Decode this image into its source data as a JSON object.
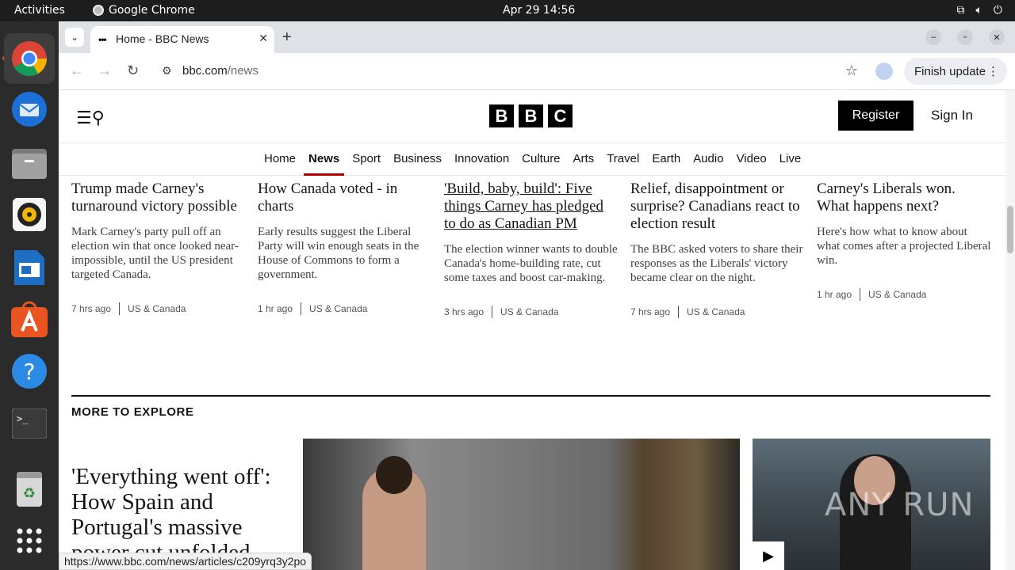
{
  "os_bar": {
    "activities": "Activities",
    "app_name": "Google Chrome",
    "clock": "Apr 29  14:56",
    "tray_icons": [
      "network-icon",
      "volume-icon",
      "power-icon"
    ]
  },
  "dock": {
    "items": [
      "chrome-icon",
      "thunderbird-icon",
      "files-icon",
      "rhythmbox-icon",
      "writer-icon",
      "app-center-icon",
      "help-icon",
      "terminal-icon",
      "trash-icon",
      "apps-grid-icon"
    ]
  },
  "browser": {
    "tab_title": "Home - BBC News",
    "tab_favicon": "•••",
    "url_host": "bbc.com",
    "url_path": "/news",
    "finish_update": "Finish update",
    "status_url": "https://www.bbc.com/news/articles/c209yrq3y2po"
  },
  "bbc": {
    "logo": [
      "B",
      "B",
      "C"
    ],
    "register": "Register",
    "sign_in": "Sign In",
    "nav": [
      "Home",
      "News",
      "Sport",
      "Business",
      "Innovation",
      "Culture",
      "Arts",
      "Travel",
      "Earth",
      "Audio",
      "Video",
      "Live"
    ],
    "nav_active": "News",
    "stories": [
      {
        "headline": "Trump made Carney's turnaround victory possible",
        "summary": "Mark Carney's party pull off an election win that once looked near-impossible, until the US president targeted Canada.",
        "time": "7 hrs ago",
        "section": "US & Canada"
      },
      {
        "headline": "How Canada voted - in charts",
        "summary": "Early results suggest the Liberal Party will win enough seats in the House of Commons to form a government.",
        "time": "1 hr ago",
        "section": "US & Canada"
      },
      {
        "headline": "'Build, baby, build': Five things Carney has pledged to do as Canadian PM",
        "summary": "The election winner wants to double Canada's home-building rate, cut some taxes and boost car-making.",
        "time": "3 hrs ago",
        "section": "US & Canada"
      },
      {
        "headline": "Relief, disappointment or surprise? Canadians react to election result",
        "summary": "The BBC asked voters to share their responses as the Liberals' victory became clear on the night.",
        "time": "7 hrs ago",
        "section": "US & Canada"
      },
      {
        "headline": "Carney's Liberals won. What happens next?",
        "summary": "Here's how what to know about what comes after a projected Liberal win.",
        "time": "1 hr ago",
        "section": "US & Canada"
      }
    ],
    "more_to_explore": "MORE TO EXPLORE",
    "feature_headline": "'Everything went off': How Spain and Portugal's massive power cut unfolded",
    "watermark": "ANY RUN"
  },
  "colors": {
    "accent_red": "#b80000",
    "topbar": "#1d1d1d",
    "dock": "#2b2b2b",
    "ubuntu_orange": "#e95420"
  }
}
